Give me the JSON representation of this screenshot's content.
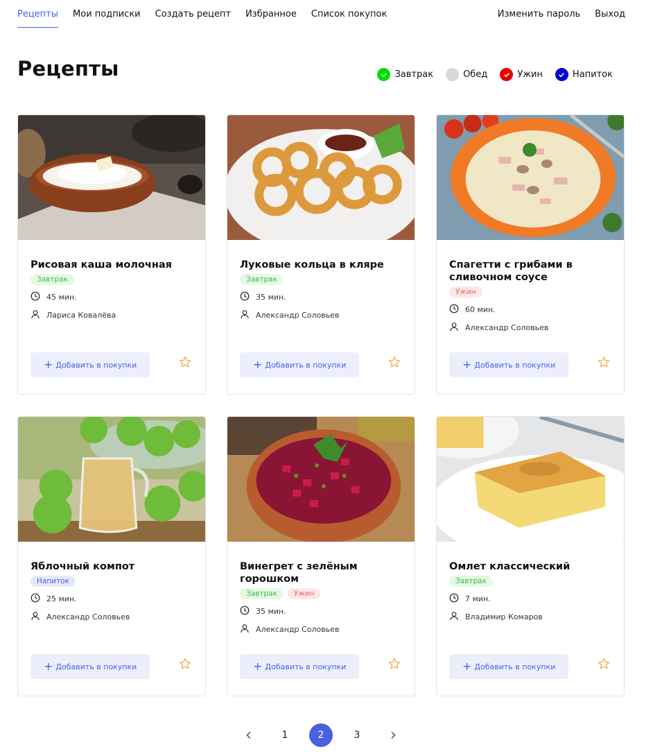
{
  "nav": {
    "left": [
      {
        "label": "Рецепты",
        "active": true
      },
      {
        "label": "Мои подписки"
      },
      {
        "label": "Создать рецепт"
      },
      {
        "label": "Избранное"
      },
      {
        "label": "Список покупок"
      }
    ],
    "right": [
      {
        "label": "Изменить пароль"
      },
      {
        "label": "Выход"
      }
    ]
  },
  "page_title": "Рецепты",
  "filters": [
    {
      "label": "Завтрак",
      "color": "#00e000",
      "checked": true
    },
    {
      "label": "Обед",
      "color": "#d8d8d8",
      "checked": false
    },
    {
      "label": "Ужин",
      "color": "#e00000",
      "checked": true
    },
    {
      "label": "Напиток",
      "color": "#0000d0",
      "checked": true
    }
  ],
  "add_button_label": "Добавить в покупки",
  "recipes": [
    {
      "title": "Рисовая каша молочная",
      "tags": [
        {
          "label": "Завтрак",
          "type": "breakfast"
        }
      ],
      "time": "45 мин.",
      "author": "Лариса Ковалёва",
      "image": "rice-porridge-photo"
    },
    {
      "title": "Луковые кольца в кляре",
      "tags": [
        {
          "label": "Завтрак",
          "type": "breakfast"
        }
      ],
      "time": "35 мин.",
      "author": "Александр Соловьев",
      "image": "onion-rings-photo"
    },
    {
      "title": "Спагетти с грибами в сливочном соусе",
      "tags": [
        {
          "label": "Ужин",
          "type": "dinner"
        }
      ],
      "time": "60 мин.",
      "author": "Александр Соловьев",
      "image": "spaghetti-photo"
    },
    {
      "title": "Яблочный компот",
      "tags": [
        {
          "label": "Напиток",
          "type": "drink"
        }
      ],
      "time": "25 мин.",
      "author": "Александр Соловьев",
      "image": "apple-compote-photo"
    },
    {
      "title": "Винегрет с зелёным горошком",
      "tags": [
        {
          "label": "Завтрак",
          "type": "breakfast"
        },
        {
          "label": "Ужин",
          "type": "dinner"
        }
      ],
      "time": "35 мин.",
      "author": "Александр Соловьев",
      "image": "vinegret-photo"
    },
    {
      "title": "Омлет классический",
      "tags": [
        {
          "label": "Завтрак",
          "type": "breakfast"
        }
      ],
      "time": "7 мин.",
      "author": "Владимир Комаров",
      "image": "omelet-photo"
    }
  ],
  "pagination": {
    "prev_icon": "chevron-left-icon",
    "next_icon": "chevron-right-icon",
    "pages": [
      "1",
      "2",
      "3"
    ],
    "current": "2"
  },
  "colors": {
    "accent": "#4a61dd",
    "star": "#f0a43a"
  }
}
